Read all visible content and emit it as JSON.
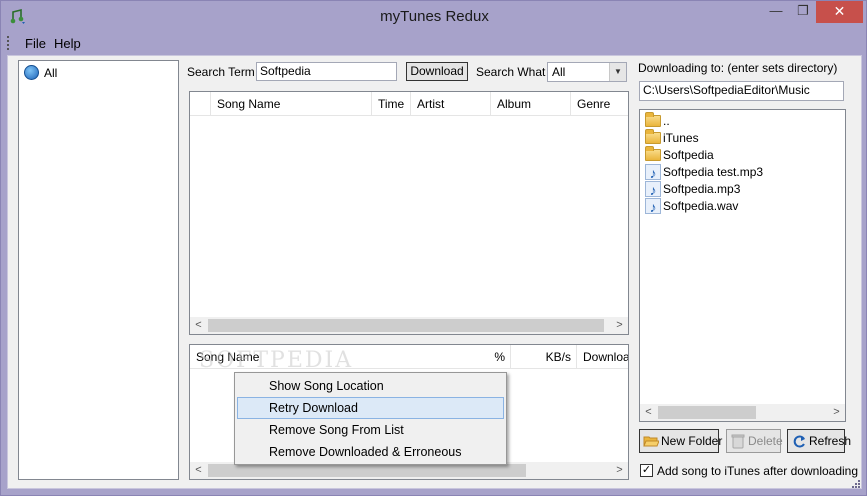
{
  "window": {
    "title": "myTunes Redux"
  },
  "menu": {
    "items": [
      "File",
      "Help"
    ]
  },
  "tree": {
    "root_label": "All"
  },
  "search": {
    "term_label": "Search Term",
    "term_value": "Softpedia",
    "download_button": "Download",
    "what_label": "Search What",
    "what_value": "All"
  },
  "results": {
    "columns": [
      "Song Name",
      "Time",
      "Artist",
      "Album",
      "Genre"
    ]
  },
  "downloads": {
    "columns": [
      "Song Name",
      "%",
      "KB/s",
      "Downloa"
    ]
  },
  "context_menu": {
    "items": [
      "Show Song Location",
      "Retry Download",
      "Remove Song From List",
      "Remove Downloaded & Erroneous"
    ],
    "highlighted": "Retry Download"
  },
  "directory": {
    "label": "Downloading to: (enter sets directory)",
    "path": "C:\\Users\\SoftpediaEditor\\Music",
    "files": [
      {
        "name": "..",
        "icon": "folder-icon"
      },
      {
        "name": "iTunes",
        "icon": "folder-icon"
      },
      {
        "name": "Softpedia",
        "icon": "folder-icon"
      },
      {
        "name": "Softpedia test.mp3",
        "icon": "music-file-icon"
      },
      {
        "name": "Softpedia.mp3",
        "icon": "music-file-icon"
      },
      {
        "name": "Softpedia.wav",
        "icon": "music-file-icon"
      }
    ]
  },
  "buttons": {
    "new_folder": "New Folder",
    "delete": "Delete",
    "refresh": "Refresh"
  },
  "options": {
    "add_to_itunes_label": "Add song to iTunes after downloading",
    "add_to_itunes_checked": true
  },
  "watermark": "SOFTPEDIA",
  "colors": {
    "window_frame": "#a7a2ca",
    "close_button": "#c7504b",
    "highlight": "#dce9f7"
  }
}
